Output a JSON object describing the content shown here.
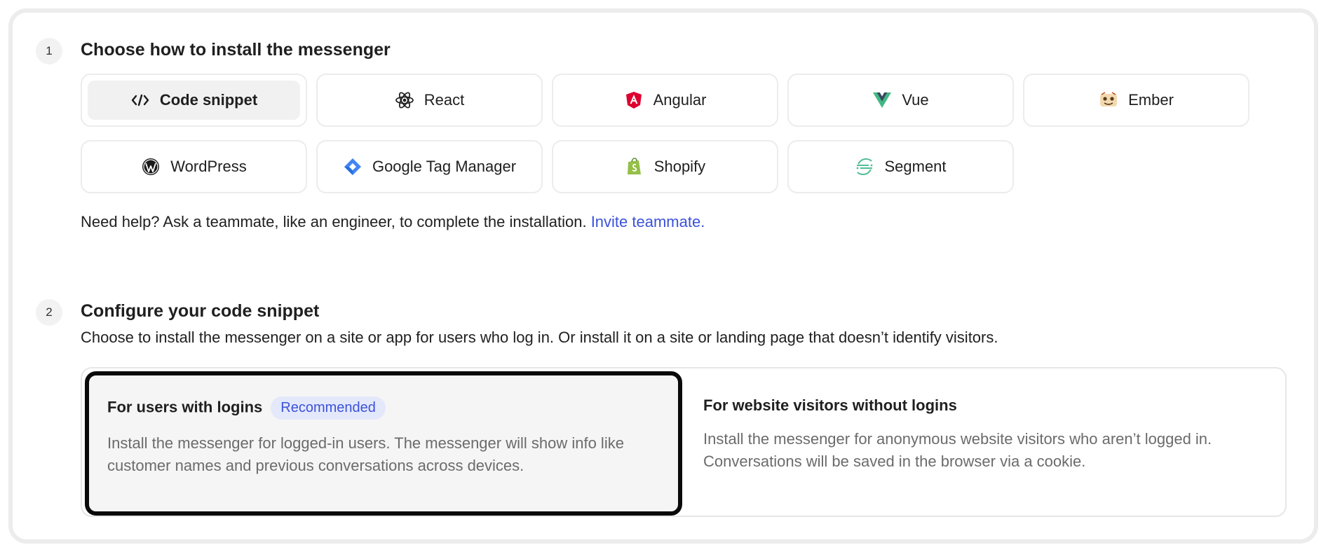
{
  "step1": {
    "number": "1",
    "title": "Choose how to install the messenger",
    "options": [
      {
        "label": "Code snippet",
        "icon": "code-icon",
        "selected": true
      },
      {
        "label": "React",
        "icon": "react-icon"
      },
      {
        "label": "Angular",
        "icon": "angular-icon",
        "color": "#dd0031"
      },
      {
        "label": "Vue",
        "icon": "vue-icon",
        "color": "#41b883"
      },
      {
        "label": "Ember",
        "icon": "ember-icon"
      },
      {
        "label": "WordPress",
        "icon": "wordpress-icon"
      },
      {
        "label": "Google Tag Manager",
        "icon": "google-tag-manager-icon",
        "color": "#4285f4"
      },
      {
        "label": "Shopify",
        "icon": "shopify-icon",
        "color": "#95bf47"
      },
      {
        "label": "Segment",
        "icon": "segment-icon",
        "color": "#52bd95"
      }
    ],
    "help_text": "Need help? Ask a teammate, like an engineer, to complete the installation.",
    "help_link": "Invite teammate."
  },
  "step2": {
    "number": "2",
    "title": "Configure your code snippet",
    "description": "Choose to install the messenger on a site or app for users who log in. Or install it on a site or landing page that doesn’t identify visitors.",
    "cards": [
      {
        "title": "For users with logins",
        "badge": "Recommended",
        "line1": "Install the messenger for logged-in users. The messenger will show info like",
        "line2": "customer names and previous conversations across devices.",
        "selected": true
      },
      {
        "title": "For website visitors without logins",
        "line1": "Install the messenger for anonymous website visitors who aren’t logged in.",
        "line2": "Conversations will be saved in the browser via a cookie."
      }
    ]
  },
  "colors": {
    "link": "#3b52d9",
    "badge_bg": "#e4e8fb",
    "selected_border": "#0a0a0a"
  }
}
